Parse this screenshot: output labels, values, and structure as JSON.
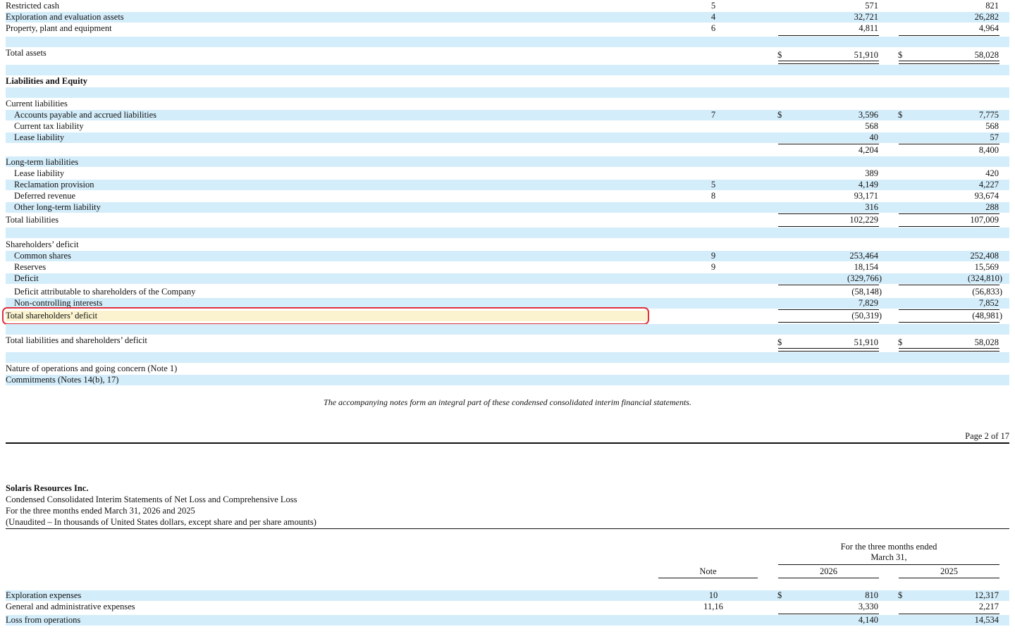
{
  "balance_sheet": {
    "assets_tail": [
      {
        "label": "Restricted cash",
        "note": "5",
        "v2026": "571",
        "v2025": "821"
      },
      {
        "label": "Exploration and evaluation assets",
        "note": "4",
        "v2026": "32,721",
        "v2025": "26,282"
      },
      {
        "label": "Property, plant and equipment",
        "note": "6",
        "v2026": "4,811",
        "v2025": "4,964"
      }
    ],
    "total_assets": {
      "label": "Total assets",
      "currency": "$",
      "v2026": "51,910",
      "v2025": "58,028"
    },
    "liab_equity_heading": "Liabilities and Equity",
    "current_liabilities": {
      "heading": "Current liabilities",
      "items": [
        {
          "label": "Accounts payable and accrued liabilities",
          "note": "7",
          "currency": "$",
          "v2026": "3,596",
          "v2025": "7,775"
        },
        {
          "label": "Current tax liability",
          "note": "",
          "v2026": "568",
          "v2025": "568"
        },
        {
          "label": "Lease liability",
          "note": "",
          "v2026": "40",
          "v2025": "57"
        }
      ],
      "subtotal": {
        "v2026": "4,204",
        "v2025": "8,400"
      }
    },
    "long_term_liabilities": {
      "heading": "Long-term liabilities",
      "items": [
        {
          "label": "Lease liability",
          "note": "",
          "v2026": "389",
          "v2025": "420"
        },
        {
          "label": "Reclamation provision",
          "note": "5",
          "v2026": "4,149",
          "v2025": "4,227"
        },
        {
          "label": "Deferred revenue",
          "note": "8",
          "v2026": "93,171",
          "v2025": "93,674"
        },
        {
          "label": "Other long-term liability",
          "note": "",
          "v2026": "316",
          "v2025": "288"
        }
      ]
    },
    "total_liabilities": {
      "label": "Total liabilities",
      "v2026": "102,229",
      "v2025": "107,009"
    },
    "shareholders_deficit": {
      "heading": "Shareholders’ deficit",
      "items": [
        {
          "label": "Common shares",
          "note": "9",
          "v2026": "253,464",
          "v2025": "252,408"
        },
        {
          "label": "Reserves",
          "note": "9",
          "v2026": "18,154",
          "v2025": "15,569"
        },
        {
          "label": "Deficit",
          "note": "",
          "v2026": "(329,766)",
          "v2025": "(324,810)"
        },
        {
          "label": "Deficit attributable to shareholders of the Company",
          "note": "",
          "v2026": "(58,148)",
          "v2025": "(56,833)"
        },
        {
          "label": "Non-controlling interests",
          "note": "",
          "v2026": "7,829",
          "v2025": "7,852"
        }
      ],
      "total": {
        "label": "Total shareholders’ deficit",
        "v2026": "(50,319)",
        "v2025": "(48,981)"
      }
    },
    "total_liab_deficit": {
      "label": "Total liabilities and shareholders’ deficit",
      "currency": "$",
      "v2026": "51,910",
      "v2025": "58,028"
    },
    "footnotes": [
      "Nature of operations and going concern (Note 1)",
      "Commitments (Notes 14(b), 17)"
    ],
    "accompanying_note": "The accompanying notes form an integral part of these condensed consolidated interim financial statements."
  },
  "page_label": "Page 2 of 17",
  "statement2": {
    "company": "Solaris Resources Inc.",
    "title": "Condensed Consolidated Interim Statements of Net Loss and Comprehensive Loss",
    "period": "For the three months ended March 31, 2026 and 2025",
    "units": "(Unaudited – In thousands of United States dollars, except share and per share amounts)",
    "col_heading_line1": "For the three months ended",
    "col_heading_line2": "March 31,",
    "note_header": "Note",
    "year1": "2026",
    "year2": "2025",
    "rows": [
      {
        "label": "Exploration expenses",
        "note": "10",
        "currency": "$",
        "v2026": "810",
        "v2025": "12,317"
      },
      {
        "label": "General and administrative expenses",
        "note": "11,16",
        "v2026": "3,330",
        "v2025": "2,217"
      },
      {
        "label": "Loss from operations",
        "note": "",
        "v2026": "4,140",
        "v2025": "14,534"
      }
    ]
  }
}
